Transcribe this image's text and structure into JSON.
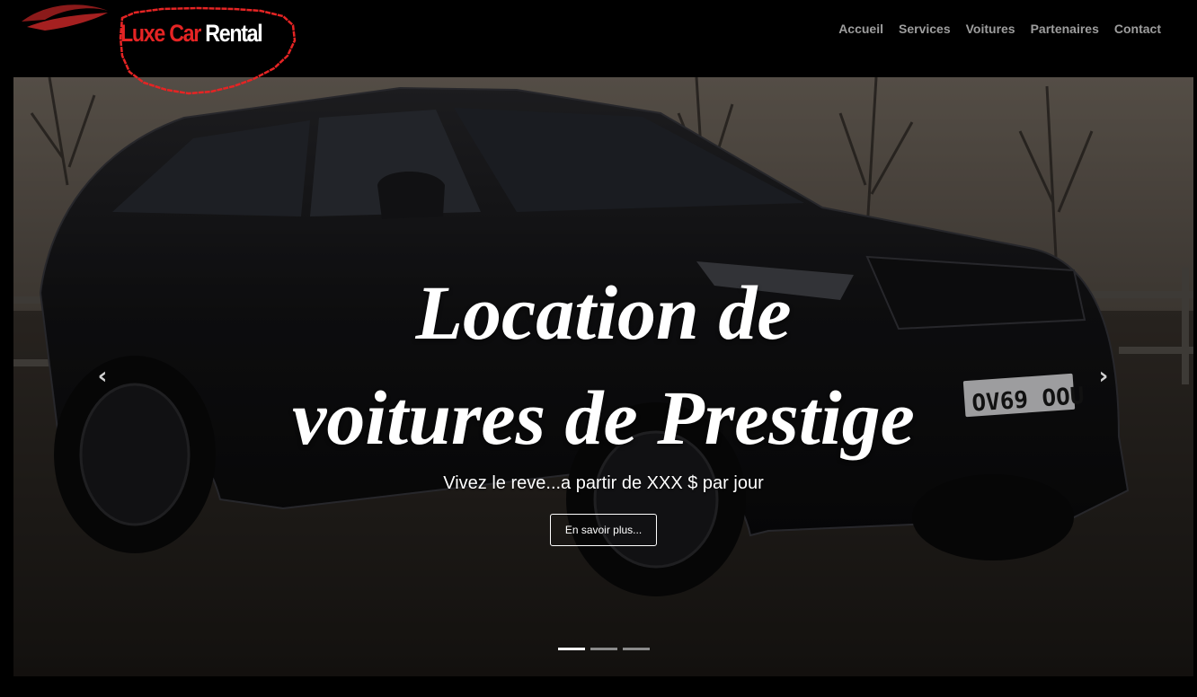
{
  "brand": {
    "word1": "Luxe Car",
    "word2": "Rental",
    "accent_color": "#e52424"
  },
  "nav": {
    "items": [
      {
        "label": "Accueil"
      },
      {
        "label": "Services"
      },
      {
        "label": "Voitures"
      },
      {
        "label": "Partenaires"
      },
      {
        "label": "Contact"
      }
    ],
    "text_color": "#9d9d9d"
  },
  "hero": {
    "headline_line1": "Location de",
    "headline_line2": "voitures de Prestige",
    "subtitle": "Vivez le reve...a partir de XXX $ par jour",
    "cta_label": "En savoir plus...",
    "prev_icon": "chevron-left-icon",
    "next_icon": "chevron-right-icon",
    "slide_count": 3,
    "active_slide": 1,
    "plate_text": "OV69 OOU"
  }
}
